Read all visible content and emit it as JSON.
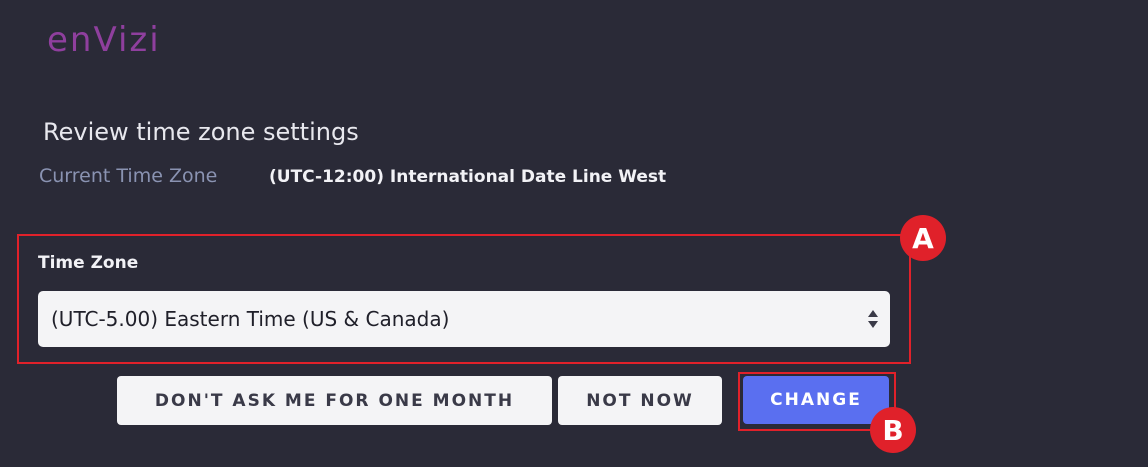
{
  "brand": {
    "logo_text": "enVizi",
    "logo_color": "#8f3f9e"
  },
  "dialog": {
    "title": "Review time zone settings",
    "current_label": "Current Time Zone",
    "current_value": "(UTC-12:00) International Date Line West",
    "field_label": "Time Zone",
    "selected_time_zone": "(UTC-5.00) Eastern Time (US & Canada)"
  },
  "buttons": {
    "dont_ask": "DON'T ASK ME FOR ONE MONTH",
    "not_now": "NOT NOW",
    "change": "CHANGE"
  },
  "annotations": {
    "a_label": "A",
    "b_label": "B",
    "color": "#e0212a"
  },
  "colors": {
    "background": "#2a2a37",
    "accent": "#5a6ff0"
  }
}
